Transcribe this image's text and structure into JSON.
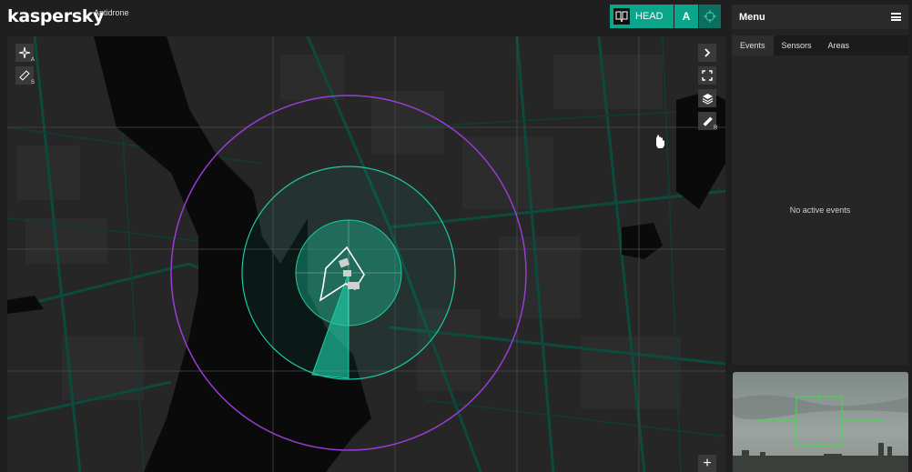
{
  "header": {
    "logo": "kaspersky",
    "logo_sub": "Antidrone",
    "head_label": "HEAD",
    "mode_a_label": "A"
  },
  "map": {
    "left_tool_keys": [
      "A",
      "S"
    ],
    "ruler_key": "R",
    "zoom_in_label": "+",
    "colors": {
      "zone": "#1ec9a4",
      "outer_ring": "#9b3bd6",
      "grid": "#4a4a4a"
    }
  },
  "panel": {
    "title": "Menu",
    "tabs": [
      {
        "label": "Events",
        "active": true
      },
      {
        "label": "Sensors",
        "active": false
      },
      {
        "label": "Areas",
        "active": false
      }
    ],
    "empty_text": "No active events"
  }
}
